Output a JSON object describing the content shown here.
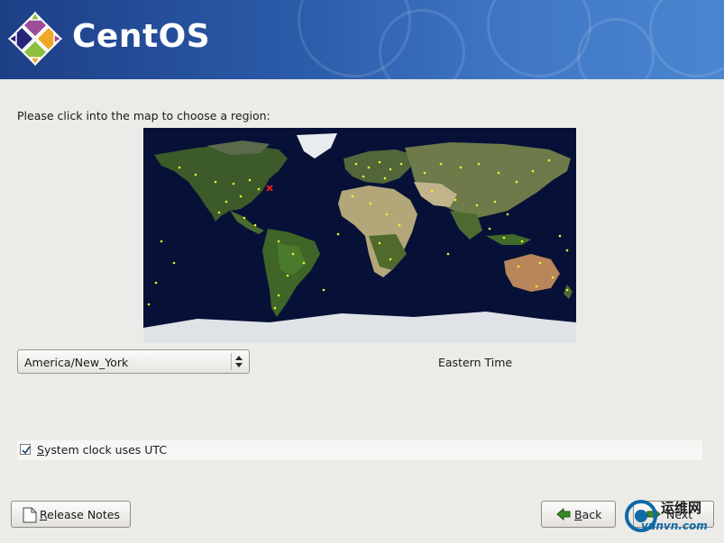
{
  "header": {
    "brand": "CentOS",
    "colors": {
      "banner": "#2a5aa8",
      "logo_purple": "#9c4d98",
      "logo_green": "#8cbf3f",
      "logo_yellow": "#efa724",
      "logo_blue": "#262577"
    }
  },
  "prompt": "Please click into the map to choose a region:",
  "map": {
    "icon": "world-map",
    "selected_marker_color": "#ff2020",
    "city_dot_color": "#f2f22a"
  },
  "timezone": {
    "selected": "America/New_York",
    "description": "Eastern Time"
  },
  "utc": {
    "checked": true,
    "label_mnemonic": "S",
    "label_rest": "ystem clock uses UTC"
  },
  "buttons": {
    "release_notes": {
      "mnemonic": "R",
      "rest": "elease Notes",
      "icon": "document-icon"
    },
    "back": {
      "mnemonic": "B",
      "rest": "ack",
      "icon": "back-arrow-icon"
    },
    "next": {
      "label": "Next",
      "icon": "next-arrow-icon"
    }
  },
  "watermark": {
    "line1": "运维网",
    "line2": "yunvn.com"
  }
}
